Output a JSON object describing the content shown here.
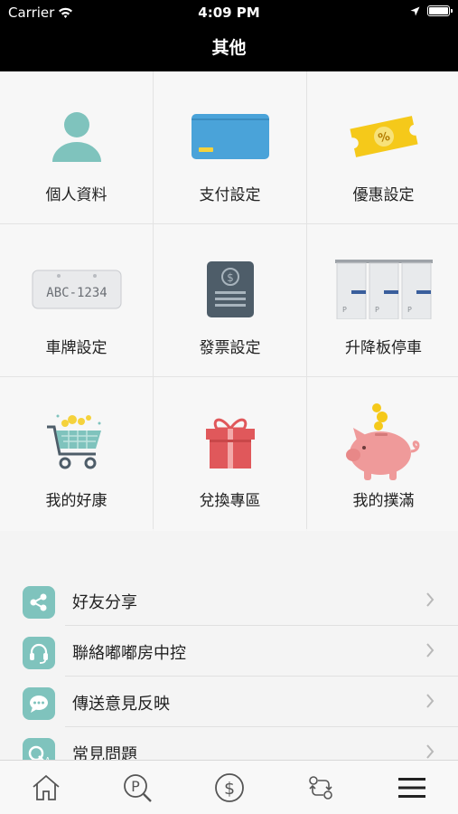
{
  "status": {
    "carrier": "Carrier",
    "time": "4:09 PM"
  },
  "header": {
    "title": "其他"
  },
  "grid": [
    {
      "label": "個人資料"
    },
    {
      "label": "支付設定"
    },
    {
      "label": "優惠設定"
    },
    {
      "label": "車牌設定",
      "plate_text": "ABC-1234"
    },
    {
      "label": "發票設定"
    },
    {
      "label": "升降板停車"
    },
    {
      "label": "我的好康"
    },
    {
      "label": "兌換專區"
    },
    {
      "label": "我的撲滿"
    }
  ],
  "list": [
    {
      "label": "好友分享",
      "icon": "share-icon"
    },
    {
      "label": "聯絡嘟嘟房中控",
      "icon": "headset-icon"
    },
    {
      "label": "傳送意見反映",
      "icon": "chat-icon"
    },
    {
      "label": "常見問題",
      "icon": "qa-icon"
    }
  ],
  "tabbar": [
    {
      "icon": "home-icon"
    },
    {
      "icon": "parking-search-icon"
    },
    {
      "icon": "dollar-icon"
    },
    {
      "icon": "exchange-icon"
    },
    {
      "icon": "menu-icon"
    }
  ],
  "colors": {
    "accent": "#7fc3bd",
    "topbar": "#000000",
    "card_blue": "#4aa3d9",
    "coupon_yellow": "#f5c91a",
    "gift_red": "#e0585b",
    "pig_pink": "#ef9a9a"
  }
}
